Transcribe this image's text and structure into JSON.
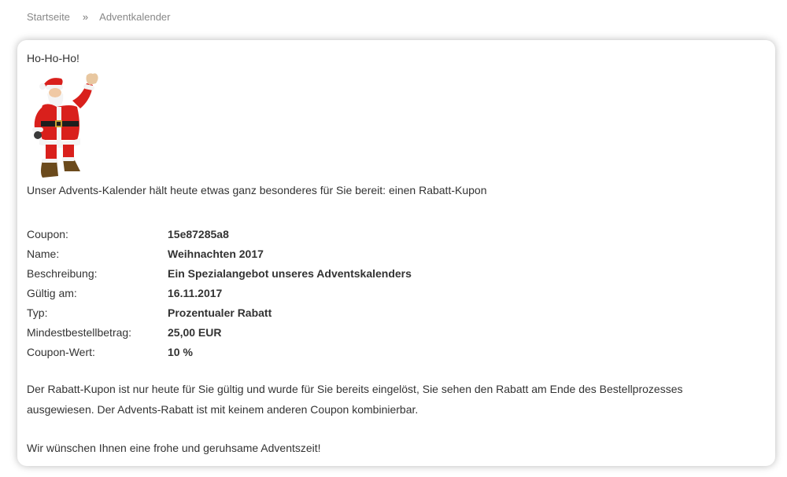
{
  "breadcrumb": {
    "home": "Startseite",
    "separator": "»",
    "current": "Adventkalender"
  },
  "content": {
    "greeting": "Ho-Ho-Ho!",
    "santa_image": "santa-claus-waving-image",
    "intro": "Unser Advents-Kalender hält heute etwas ganz besonderes für Sie bereit: einen Rabatt-Kupon",
    "coupon": {
      "rows": [
        {
          "label": "Coupon:",
          "value": "15e87285a8"
        },
        {
          "label": "Name:",
          "value": "Weihnachten 2017"
        },
        {
          "label": "Beschreibung:",
          "value": "Ein Spezialangebot unseres Adventskalenders"
        },
        {
          "label": "Gültig am:",
          "value": "16.11.2017"
        },
        {
          "label": "Typ:",
          "value": "Prozentualer Rabatt"
        },
        {
          "label": "Mindestbestellbetrag:",
          "value": "25,00 EUR"
        },
        {
          "label": "Coupon-Wert:",
          "value": "10 %"
        }
      ]
    },
    "note": "Der Rabatt-Kupon ist nur heute für Sie gültig und wurde für Sie bereits eingelöst, Sie sehen den Rabatt am Ende des Bestellprozesses ausgewiesen. Der Advents-Rabatt ist mit keinem anderen Coupon kombinierbar.",
    "closing": "Wir wünschen Ihnen eine frohe und geruhsame Adventszeit!"
  },
  "colors": {
    "santa_red": "#d9201c",
    "fur_white": "#f4f4f4",
    "boot_brown": "#6b4a1c",
    "text": "#333333",
    "breadcrumb": "#888888"
  }
}
